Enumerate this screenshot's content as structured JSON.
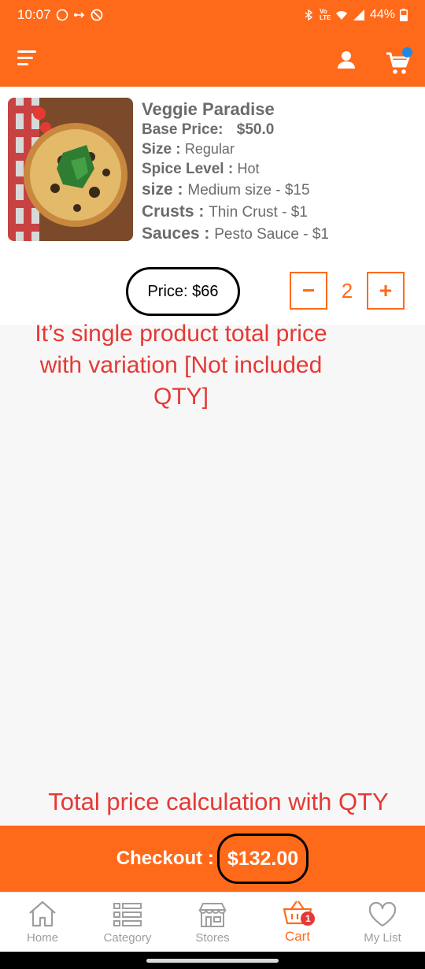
{
  "status_bar": {
    "time": "10:07",
    "battery": "44%",
    "network_label": "Vo LTE"
  },
  "app_bar": {
    "menu_icon": "menu-icon",
    "profile_icon": "person-icon",
    "cart_icon": "cart-icon"
  },
  "cart_item": {
    "name": "Veggie Paradise",
    "base_price_label": "Base Price:",
    "base_price": "$50.0",
    "size_label": "Size :",
    "size_value": "Regular",
    "spice_label": "Spice Level :",
    "spice_value": "Hot",
    "variant_size_label": "size :",
    "variant_size_value": "Medium size - $15",
    "crusts_label": "Crusts :",
    "crusts_value": "Thin Crust - $1",
    "sauces_label": "Sauces :",
    "sauces_value": "Pesto Sauce - $1",
    "price_text": "Price: $66",
    "minus_label": "−",
    "quantity": "2",
    "plus_label": "+"
  },
  "annotations": {
    "single_price_note": "It’s single product total price with variation [Not included QTY]",
    "total_note": "Total price calculation with QTY"
  },
  "checkout": {
    "label": "Checkout :",
    "amount": "$132.00"
  },
  "bottom_nav": {
    "items": [
      {
        "label": "Home",
        "icon": "home-icon"
      },
      {
        "label": "Category",
        "icon": "category-list-icon"
      },
      {
        "label": "Stores",
        "icon": "store-icon"
      },
      {
        "label": "Cart",
        "icon": "basket-icon",
        "badge": "1"
      },
      {
        "label": "My List",
        "icon": "heart-icon"
      }
    ],
    "active": "Cart"
  },
  "colors": {
    "brand": "#ff6a1a",
    "annotation": "#e53935",
    "badge_dot": "#1e88e5"
  }
}
